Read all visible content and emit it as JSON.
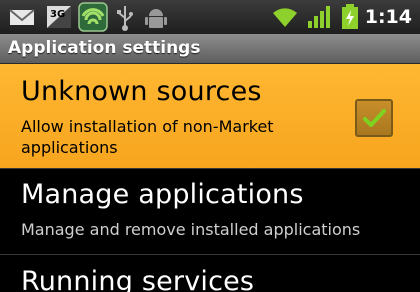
{
  "status_bar": {
    "time": "1:14",
    "icons": [
      "gmail-icon",
      "3g-icon",
      "signal-app-icon",
      "usb-icon",
      "android-debug-icon",
      "wifi-icon",
      "cell-signal-icon",
      "battery-charging-icon"
    ],
    "network_label": "3G"
  },
  "title_bar": {
    "title": "Application settings"
  },
  "settings": {
    "unknown_sources": {
      "title": "Unknown sources",
      "summary": "Allow installation of non-Market applications",
      "checked": true
    },
    "manage_applications": {
      "title": "Manage applications",
      "summary": "Manage and remove installed applications"
    },
    "running_services": {
      "title": "Running services"
    }
  },
  "colors": {
    "highlight": "#f9a825",
    "check": "#7ed321"
  }
}
